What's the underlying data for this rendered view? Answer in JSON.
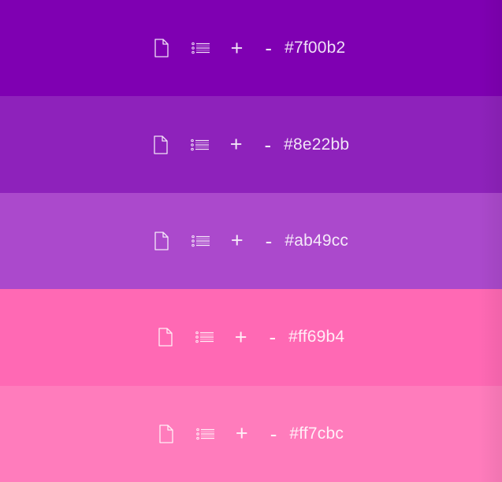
{
  "swatches": [
    {
      "color": "#7f00b2",
      "hex_label": "#7f00b2",
      "plus_label": "+",
      "minus_label": "-",
      "icons": [
        "document-icon",
        "list-icon"
      ]
    },
    {
      "color": "#8e22bb",
      "hex_label": "#8e22bb",
      "plus_label": "+",
      "minus_label": "-",
      "icons": [
        "document-icon",
        "list-icon"
      ]
    },
    {
      "color": "#ab49cc",
      "hex_label": "#ab49cc",
      "plus_label": "+",
      "minus_label": "-",
      "icons": [
        "document-icon",
        "list-icon"
      ]
    },
    {
      "color": "#ff69b4",
      "hex_label": "#ff69b4",
      "plus_label": "+",
      "minus_label": "-",
      "icons": [
        "document-icon",
        "list-icon"
      ]
    },
    {
      "color": "#ff7cbc",
      "hex_label": "#ff7cbc",
      "plus_label": "+",
      "minus_label": "-",
      "icons": [
        "document-icon",
        "list-icon"
      ]
    }
  ]
}
